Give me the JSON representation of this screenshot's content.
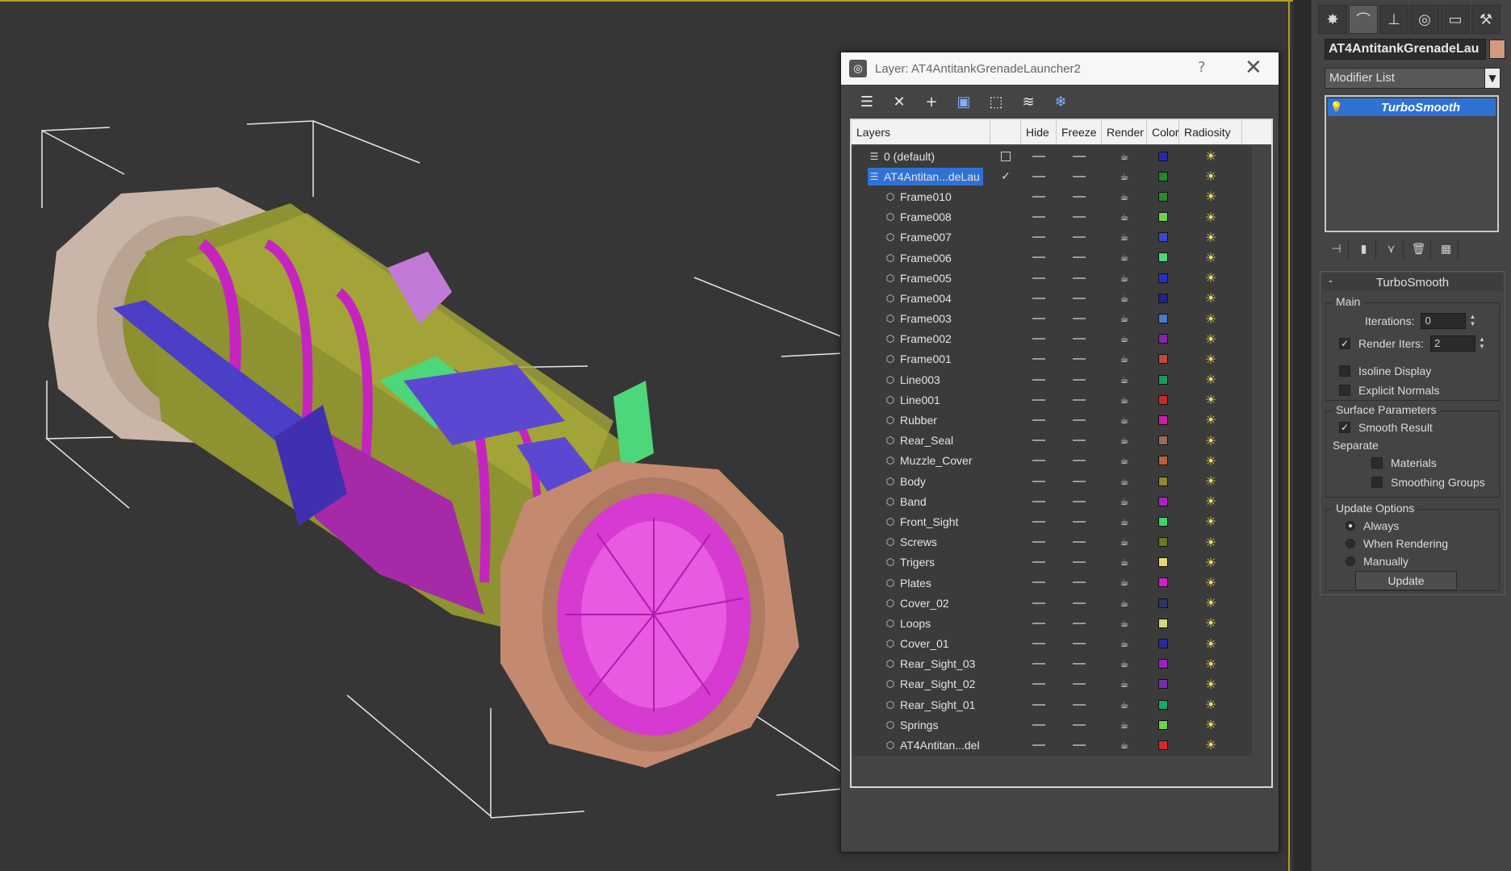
{
  "dialog": {
    "title": "Layer: AT4AntitankGrenadeLauncher2",
    "help": "?",
    "columns": [
      "Layers",
      "Hide",
      "Freeze",
      "Render",
      "Color",
      "Radiosity"
    ],
    "layers": [
      {
        "name": "0 (default)",
        "color": "#2a2aa8",
        "type": "layer",
        "indent": 0
      },
      {
        "name": "AT4Antitan...deLau",
        "color": "#1f8a2a",
        "type": "layer",
        "indent": 0,
        "selected": true,
        "current": true
      },
      {
        "name": "Frame010",
        "color": "#2a8a2a",
        "type": "object",
        "indent": 1
      },
      {
        "name": "Frame008",
        "color": "#6fd14a",
        "type": "object",
        "indent": 1
      },
      {
        "name": "Frame007",
        "color": "#3a4ad0",
        "type": "object",
        "indent": 1
      },
      {
        "name": "Frame006",
        "color": "#4ad67a",
        "type": "object",
        "indent": 1
      },
      {
        "name": "Frame005",
        "color": "#2432c8",
        "type": "object",
        "indent": 1
      },
      {
        "name": "Frame004",
        "color": "#22238a",
        "type": "object",
        "indent": 1
      },
      {
        "name": "Frame003",
        "color": "#4a7ad0",
        "type": "object",
        "indent": 1
      },
      {
        "name": "Frame002",
        "color": "#8a22b0",
        "type": "object",
        "indent": 1
      },
      {
        "name": "Frame001",
        "color": "#c04a3a",
        "type": "object",
        "indent": 1
      },
      {
        "name": "Line003",
        "color": "#1a9a5a",
        "type": "object",
        "indent": 1
      },
      {
        "name": "Line001",
        "color": "#c82a2a",
        "type": "object",
        "indent": 1
      },
      {
        "name": "Rubber",
        "color": "#d01ab0",
        "type": "object",
        "indent": 1
      },
      {
        "name": "Rear_Seal",
        "color": "#9a6a5a",
        "type": "object",
        "indent": 1
      },
      {
        "name": "Muzzle_Cover",
        "color": "#b8603a",
        "type": "object",
        "indent": 1
      },
      {
        "name": "Body",
        "color": "#8a8a2a",
        "type": "object",
        "indent": 1
      },
      {
        "name": "Band",
        "color": "#b020c0",
        "type": "object",
        "indent": 1
      },
      {
        "name": "Front_Sight",
        "color": "#3ad66a",
        "type": "object",
        "indent": 1
      },
      {
        "name": "Screws",
        "color": "#6a7a22",
        "type": "object",
        "indent": 1
      },
      {
        "name": "Trigers",
        "color": "#e8d86a",
        "type": "object",
        "indent": 1
      },
      {
        "name": "Plates",
        "color": "#d020c8",
        "type": "object",
        "indent": 1
      },
      {
        "name": "Cover_02",
        "color": "#32326a",
        "type": "object",
        "indent": 1
      },
      {
        "name": "Loops",
        "color": "#d6d67a",
        "type": "object",
        "indent": 1
      },
      {
        "name": "Cover_01",
        "color": "#2a2a9a",
        "type": "object",
        "indent": 1
      },
      {
        "name": "Rear_Sight_03",
        "color": "#a020c0",
        "type": "object",
        "indent": 1
      },
      {
        "name": "Rear_Sight_02",
        "color": "#7a2ab0",
        "type": "object",
        "indent": 1
      },
      {
        "name": "Rear_Sight_01",
        "color": "#1aa86a",
        "type": "object",
        "indent": 1
      },
      {
        "name": "Springs",
        "color": "#6ad64a",
        "type": "object",
        "indent": 1
      },
      {
        "name": "AT4Antitan...del",
        "color": "#d22a2a",
        "type": "object",
        "indent": 1
      }
    ]
  },
  "panel": {
    "object_name": "AT4AntitankGrenadeLau",
    "object_color": "#d29a7e",
    "modifier_list": "Modifier List",
    "stack_item": "TurboSmooth",
    "rollout_title": "TurboSmooth",
    "main_group": "Main",
    "iterations_label": "Iterations:",
    "iterations_value": "0",
    "render_iters_label": "Render Iters:",
    "render_iters_value": "2",
    "isoline_label": "Isoline Display",
    "explicit_normals_label": "Explicit Normals",
    "surface_group": "Surface Parameters",
    "smooth_result_label": "Smooth Result",
    "separate_label": "Separate",
    "materials_label": "Materials",
    "smoothing_groups_label": "Smoothing Groups",
    "update_group": "Update Options",
    "always_label": "Always",
    "when_rendering_label": "When Rendering",
    "manually_label": "Manually",
    "update_button": "Update"
  }
}
